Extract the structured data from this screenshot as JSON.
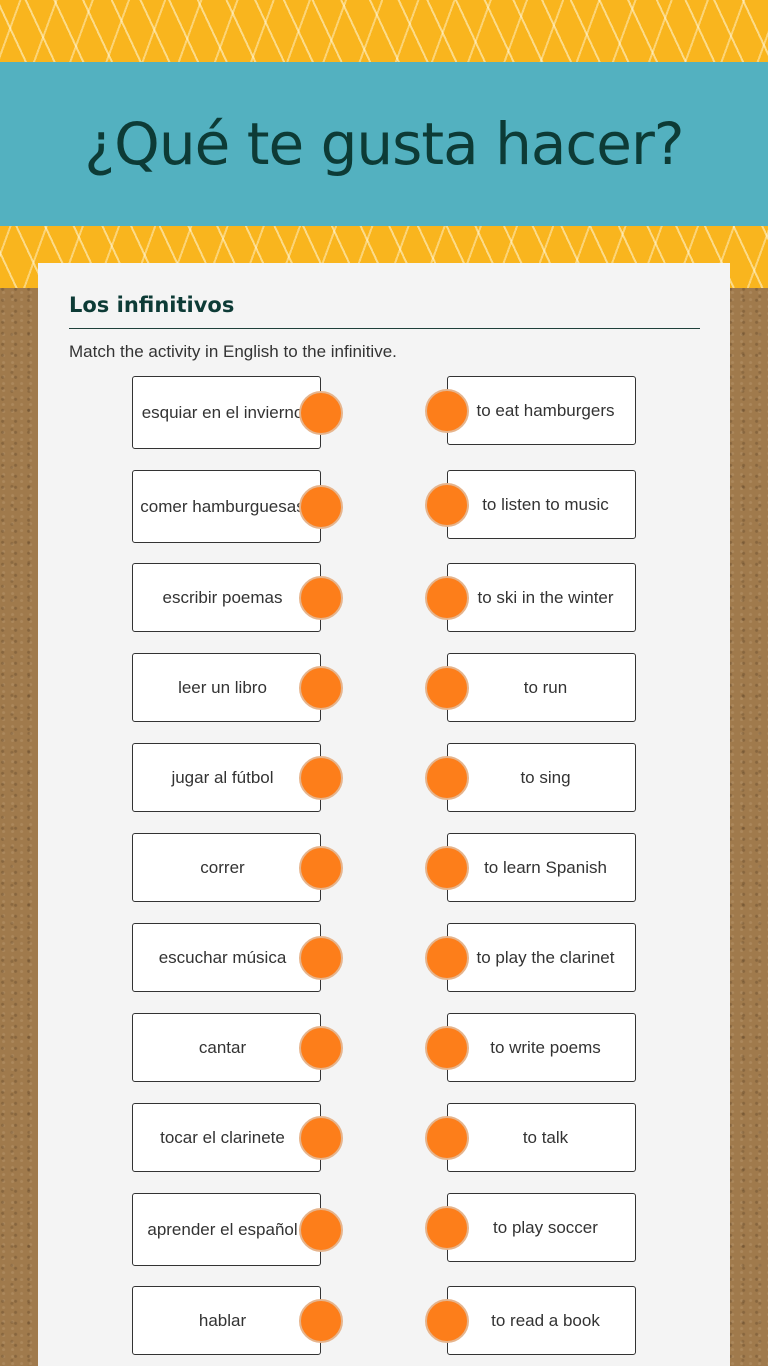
{
  "header": {
    "title": "¿Qué te gusta hacer?"
  },
  "section": {
    "title": "Los infinitivos",
    "instructions": "Match the activity in English to the infinitive."
  },
  "colors": {
    "banner_yellow": "#f9b51e",
    "header_teal": "#53b1c0",
    "title_text": "#0d3b36",
    "dot_orange": "#fd7e1a"
  },
  "left_items": [
    {
      "label": "esquiar en el invierno"
    },
    {
      "label": "comer hamburguesas"
    },
    {
      "label": "escribir poemas"
    },
    {
      "label": "leer un libro"
    },
    {
      "label": "jugar al fútbol"
    },
    {
      "label": "correr"
    },
    {
      "label": "escuchar música"
    },
    {
      "label": "cantar"
    },
    {
      "label": "tocar el clarinete"
    },
    {
      "label": "aprender el español"
    },
    {
      "label": "hablar"
    }
  ],
  "right_items": [
    {
      "label": "to eat hamburgers"
    },
    {
      "label": "to listen to music"
    },
    {
      "label": "to ski in the winter"
    },
    {
      "label": "to run"
    },
    {
      "label": "to sing"
    },
    {
      "label": "to learn Spanish"
    },
    {
      "label": "to play the clarinet"
    },
    {
      "label": "to write poems"
    },
    {
      "label": "to talk"
    },
    {
      "label": "to play soccer"
    },
    {
      "label": "to read a book"
    }
  ]
}
